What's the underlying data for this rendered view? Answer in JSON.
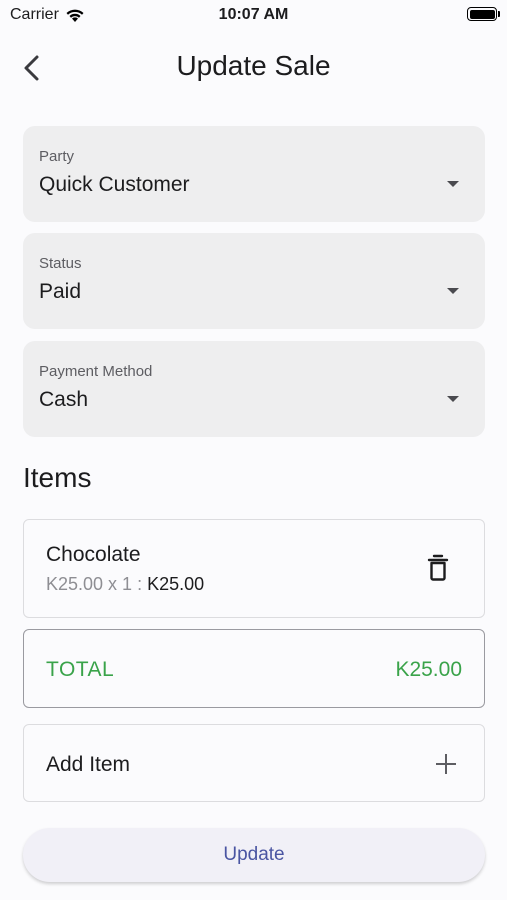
{
  "status_bar": {
    "carrier": "Carrier",
    "time": "10:07 AM",
    "wifi_icon": "wifi-icon",
    "battery_icon": "battery-icon"
  },
  "app_bar": {
    "title": "Update Sale",
    "back_icon": "back-chevron-icon"
  },
  "fields": {
    "party": {
      "label": "Party",
      "value": "Quick Customer"
    },
    "status": {
      "label": "Status",
      "value": "Paid"
    },
    "payment_method": {
      "label": "Payment Method",
      "value": "Cash"
    }
  },
  "items_section": {
    "title": "Items",
    "items": [
      {
        "name": "Chocolate",
        "unit_line": "K25.00 x 1 : ",
        "subtotal": "K25.00",
        "delete_icon": "trash-icon"
      }
    ],
    "total": {
      "label": "TOTAL",
      "value": "K25.00"
    },
    "add_item": {
      "label": "Add Item",
      "icon": "plus-icon"
    }
  },
  "actions": {
    "update_label": "Update"
  },
  "colors": {
    "accent": "#4a55a2",
    "total_green": "#3aa34a",
    "field_bg": "#eeeeef"
  }
}
